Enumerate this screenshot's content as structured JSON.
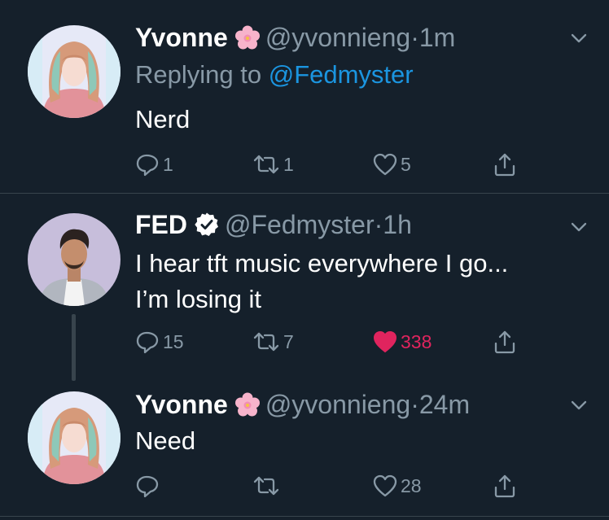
{
  "tweets": [
    {
      "name": "Yvonne",
      "name_badge": "cherry-blossom",
      "handle": "@yvonnieng",
      "separator": "·",
      "time": "1m",
      "replying_prefix": "Replying to",
      "replying_to": "@Fedmyster",
      "text_lines": [
        "Nerd"
      ],
      "replies": "1",
      "retweets": "1",
      "likes": "5",
      "liked": false
    },
    {
      "name": "FED",
      "name_badge": "verified",
      "handle": "@Fedmyster",
      "separator": "·",
      "time": "1h",
      "text_lines": [
        "I hear tft music everywhere I go...",
        "I’m losing it"
      ],
      "replies": "15",
      "retweets": "7",
      "likes": "338",
      "liked": true
    },
    {
      "name": "Yvonne",
      "name_badge": "cherry-blossom",
      "handle": "@yvonnieng",
      "separator": "·",
      "time": "24m",
      "text_lines": [
        "Need"
      ],
      "replies": "",
      "retweets": "",
      "likes": "28",
      "liked": false
    }
  ],
  "colors": {
    "background": "#15202b",
    "divider": "#38444d",
    "secondary_text": "#8899a6",
    "link": "#1b95e0",
    "like_active": "#e0245e"
  },
  "icons": [
    "chevron-down-icon",
    "reply-icon",
    "retweet-icon",
    "like-icon",
    "share-icon",
    "verified-badge-icon",
    "cherry-blossom-emoji"
  ]
}
